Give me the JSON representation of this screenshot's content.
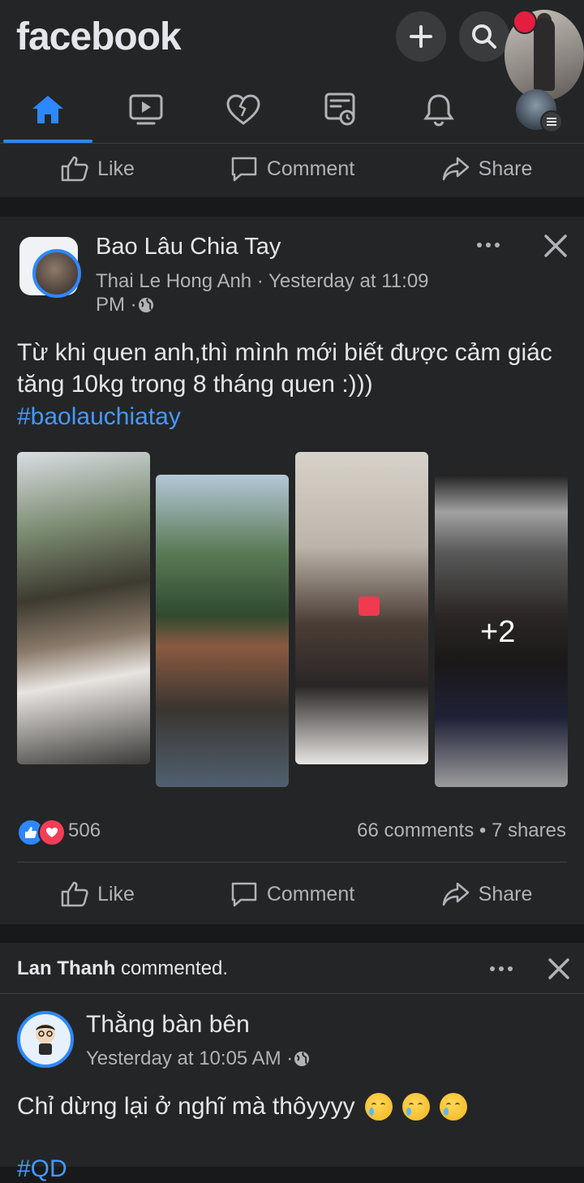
{
  "header": {
    "logo": "facebook"
  },
  "nav": {
    "items": [
      "home-icon",
      "watch-icon",
      "dating-icon",
      "feeds-icon",
      "notifications-icon",
      "menu-icon"
    ],
    "active": "home-icon"
  },
  "top_actions": {
    "like": "Like",
    "comment": "Comment",
    "share": "Share"
  },
  "post1": {
    "page_name": "Bao Lâu Chia Tay",
    "author": "Thai Le Hong Anh",
    "time_line1": " · Yesterday at 11:09",
    "time_line2": "PM · ",
    "text_line1": "Từ khi quen anh,thì mình mới biết được cảm giác",
    "text_line2": "tăng 10kg trong 8 tháng quen :)))",
    "hashtag": "#baolauchiatay",
    "more_photos": "+2",
    "reaction_count": "506",
    "comments_shares": "66 comments • 7 shares",
    "actions": {
      "like": "Like",
      "comment": "Comment",
      "share": "Share"
    }
  },
  "post2": {
    "activity_name": "Lan Thanh",
    "activity_text": " commented.",
    "author": "Thằng bàn bên",
    "time": "Yesterday at 10:05 AM · ",
    "text": "Chỉ dừng lại ở nghĩ mà thôyyyy",
    "hashtag_partial": "#QD"
  },
  "colors": {
    "background": "#18191a",
    "card": "#242526",
    "text": "#e4e6eb",
    "secondary_text": "#b0b3b8",
    "accent": "#2d88ff",
    "link": "#4599ff"
  }
}
